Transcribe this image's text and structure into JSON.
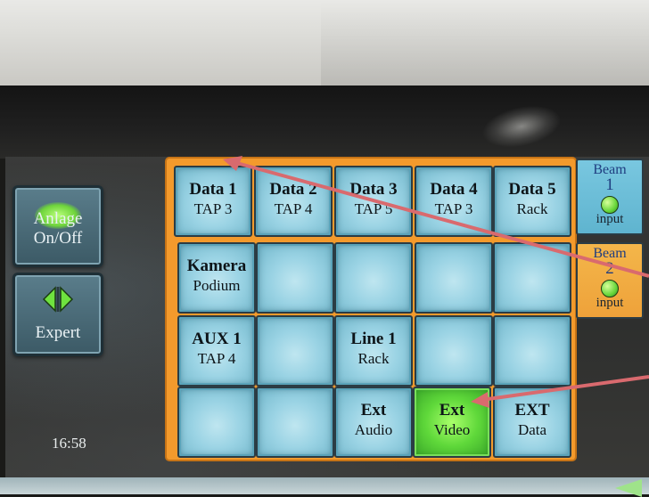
{
  "colors": {
    "panel_orange": "#f39a2c",
    "button_blue": "#9ad3e4",
    "active_green": "#5fd83a",
    "annotation_red": "#d96a6e"
  },
  "sidebar": {
    "power_button": {
      "line1": "Anlage",
      "line2": "On/Off",
      "icon": "power-glow-icon"
    },
    "expert_button": {
      "label": "Expert",
      "icon": "left-right-arrows-icon"
    },
    "clock": "16:58"
  },
  "grid": {
    "rows": [
      [
        {
          "title": "Data 1",
          "sub": "TAP 3"
        },
        {
          "title": "Data 2",
          "sub": "TAP 4"
        },
        {
          "title": "Data 3",
          "sub": "TAP 5"
        },
        {
          "title": "Data 4",
          "sub": "TAP 3"
        },
        {
          "title": "Data 5",
          "sub": "Rack"
        }
      ],
      [
        {
          "title": "Kamera",
          "sub": "Podium"
        },
        {
          "title": "",
          "sub": ""
        },
        {
          "title": "",
          "sub": ""
        },
        {
          "title": "",
          "sub": ""
        },
        {
          "title": "",
          "sub": ""
        }
      ],
      [
        {
          "title": "AUX 1",
          "sub": "TAP 4"
        },
        {
          "title": "",
          "sub": ""
        },
        {
          "title": "Line 1",
          "sub": "Rack"
        },
        {
          "title": "",
          "sub": ""
        },
        {
          "title": "",
          "sub": ""
        }
      ],
      [
        {
          "title": "",
          "sub": ""
        },
        {
          "title": "",
          "sub": ""
        },
        {
          "title": "Ext",
          "sub": "Audio"
        },
        {
          "title": "Ext",
          "sub": "Video",
          "active": true
        },
        {
          "title": "EXT",
          "sub": "Data"
        }
      ]
    ]
  },
  "beams": [
    {
      "line1": "Beam",
      "line2": "1",
      "label": "input"
    },
    {
      "line1": "Beam",
      "line2": "2",
      "label": "input"
    }
  ]
}
